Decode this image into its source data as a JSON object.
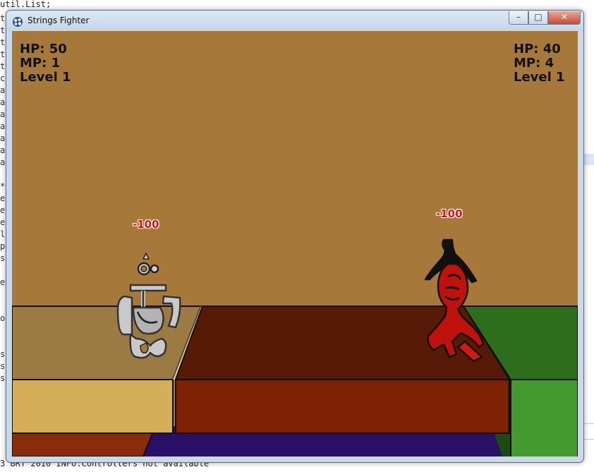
{
  "ide": {
    "top_line": "util.List;",
    "bottom_line": "3 BRT 2010 INFO:Controllers not available",
    "gutter": [
      "te",
      "te",
      "te",
      "te",
      "te",
      "ce",
      "ae",
      "ae",
      "ae",
      "ae",
      "ae",
      "ae",
      "ae",
      "",
      "*",
      "e",
      "e",
      "e",
      "l",
      "p",
      "s",
      "",
      "es",
      "",
      "",
      "o",
      "",
      "",
      "st",
      "st",
      "st",
      ""
    ]
  },
  "window": {
    "title": "Strings Fighter",
    "minimize_glyph": "–",
    "maximize_glyph": "□",
    "close_glyph": "✕"
  },
  "player_left": {
    "hp": "HP: 50",
    "mp": "MP: 1",
    "level": "Level 1",
    "damage": "-100",
    "color": "#c9c9c9"
  },
  "player_right": {
    "hp": "HP: 40",
    "mp": "MP: 4",
    "level": "Level 1",
    "damage": "-100",
    "color": "#c0120c"
  },
  "colors": {
    "wall": "#a6793a",
    "platform_left_top": "#9b7a43",
    "platform_left_front": "#d6ae5a",
    "platform_center_top": "#561a06",
    "platform_center_front": "#7d2204",
    "platform_right_top": "#2c6e1c",
    "platform_right_front": "#44992f",
    "floor_purple": "#2a0f66"
  }
}
